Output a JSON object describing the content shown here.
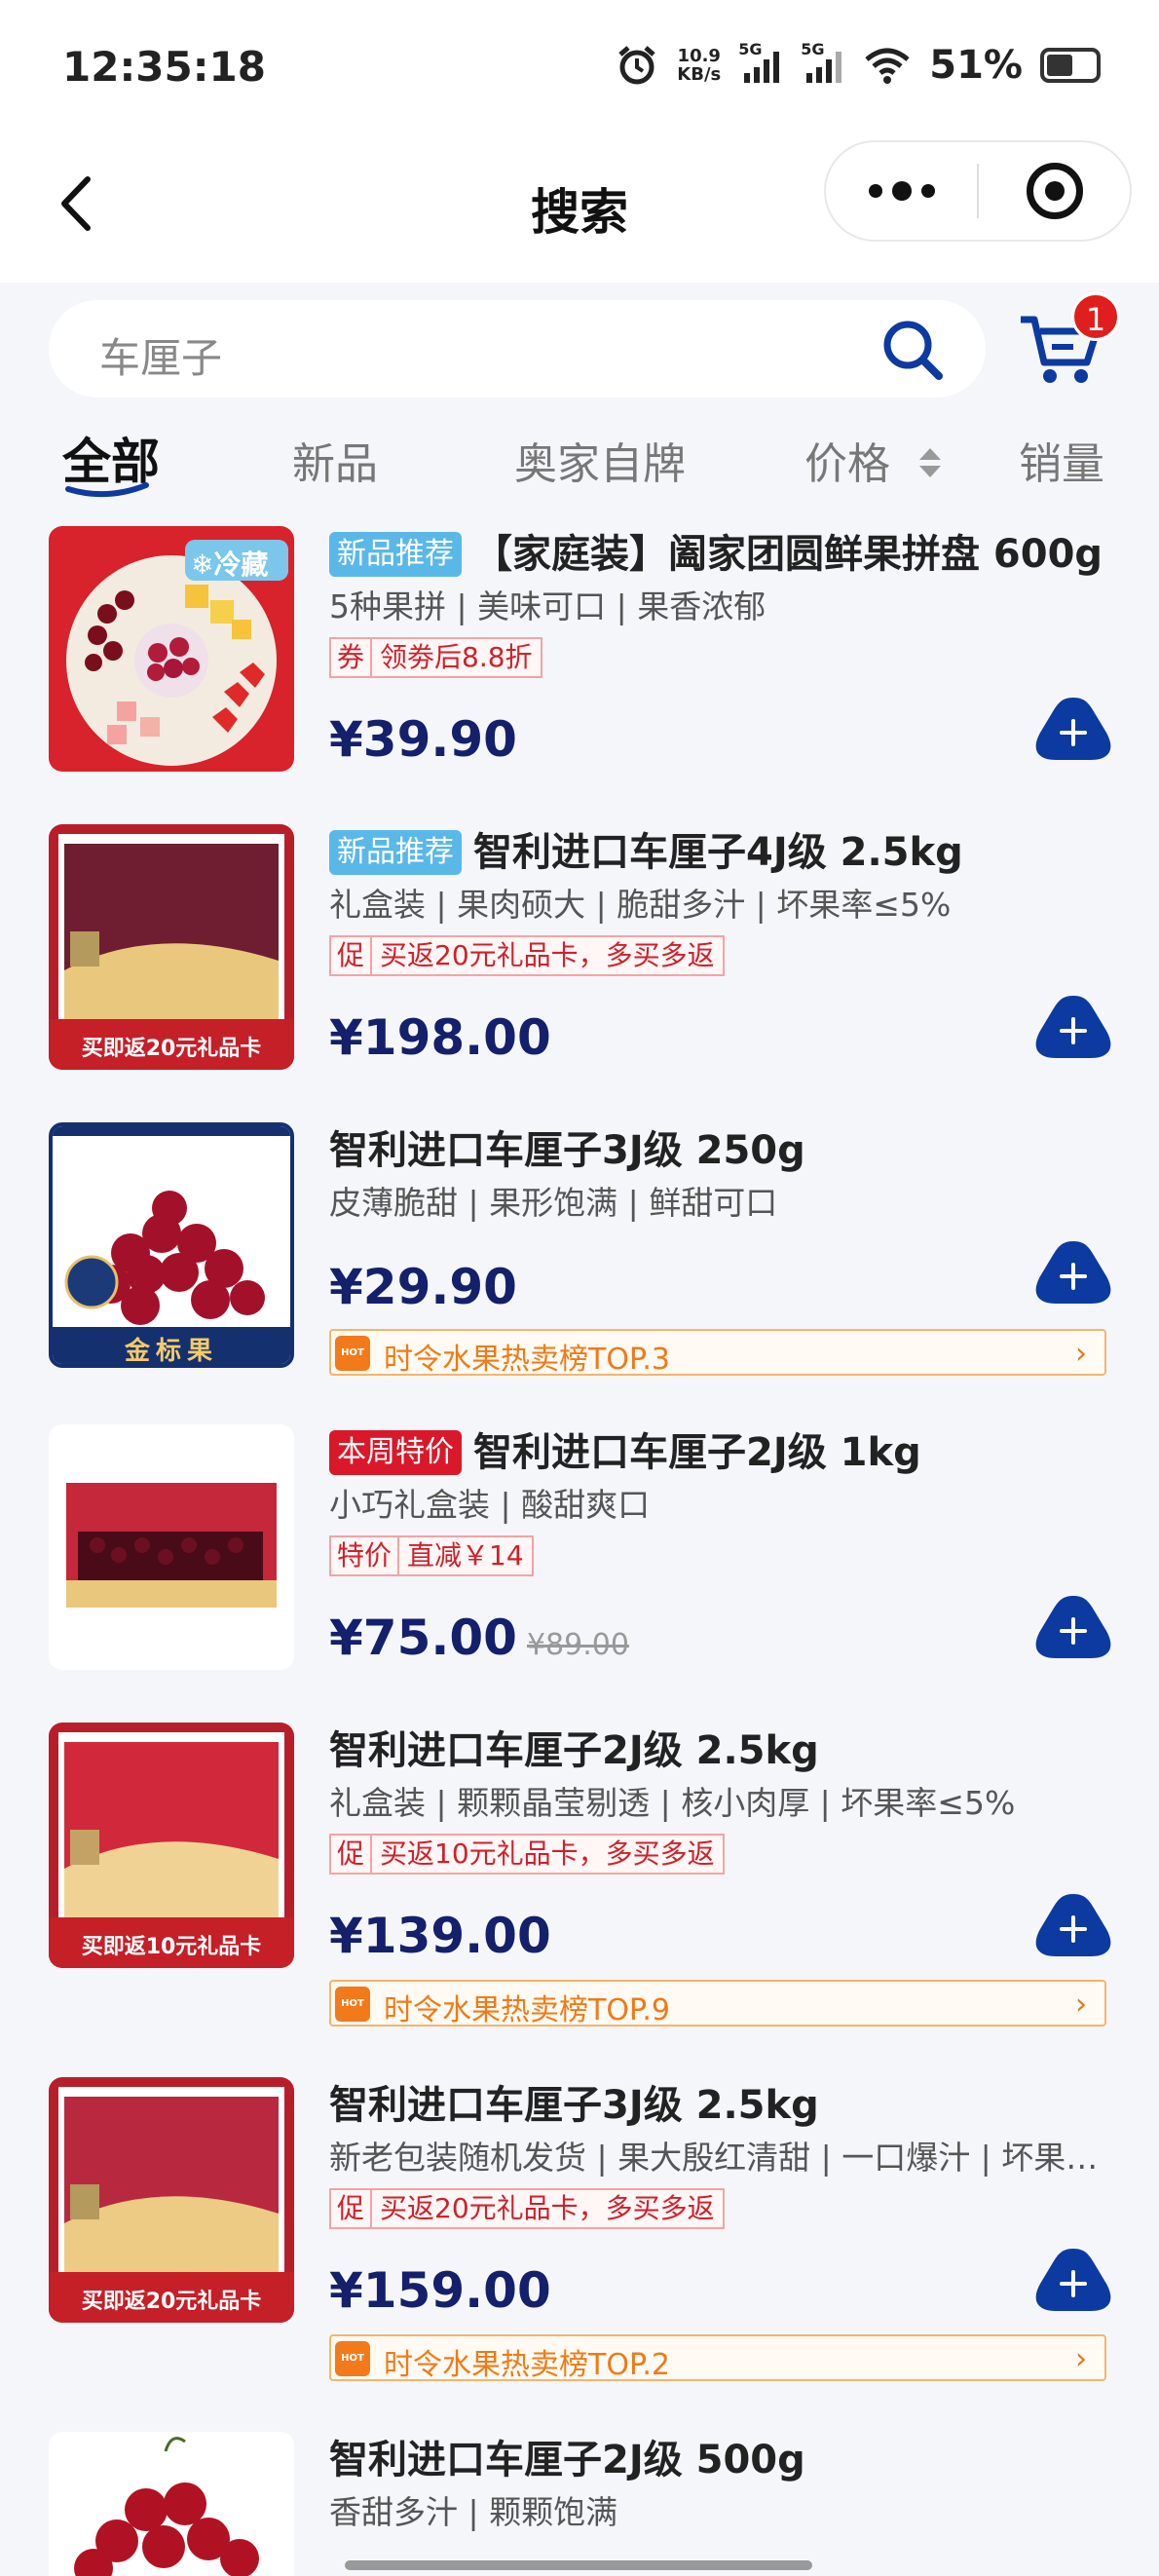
{
  "status_bar": {
    "time": "12:35:18",
    "net_speed_value": "10.9",
    "net_speed_unit": "KB/s",
    "signal_1": "5G",
    "signal_2": "5G",
    "battery": "51%"
  },
  "nav": {
    "title": "搜索"
  },
  "search": {
    "query": "车厘子"
  },
  "cart": {
    "count": "1"
  },
  "tabs": [
    {
      "label": "全部"
    },
    {
      "label": "新品"
    },
    {
      "label": "奥家自牌"
    },
    {
      "label": "价格"
    },
    {
      "label": "销量"
    }
  ],
  "products": [
    {
      "badge": "新品推荐",
      "title": "【家庭装】阖家团圆鲜果拼盘 600g",
      "subtitle": "5种果拼 | 美味可口 | 果香浓郁",
      "promo_key": "券",
      "promo_text": "领劵后8.8折",
      "price": "¥39.90",
      "thumb_label": "❄冷藏"
    },
    {
      "badge": "新品推荐",
      "title": "智利进口车厘子4J级 2.5kg",
      "subtitle": "礼盒装 | 果肉硕大 | 脆甜多汁 | 坏果率≤5%",
      "promo_key": "促",
      "promo_text": "买返20元礼品卡，多买多返",
      "price": "¥198.00",
      "thumb_label": "买即返20元礼品卡"
    },
    {
      "title": "智利进口车厘子3J级 250g",
      "subtitle": "皮薄脆甜 | 果形饱满 | 鲜甜可口",
      "price": "¥29.90",
      "rank": "时令水果热卖榜TOP.3",
      "thumb_label": "金标果"
    },
    {
      "badge": "本周特价",
      "title": "智利进口车厘子2J级 1kg",
      "subtitle": "小巧礼盒装 | 酸甜爽口",
      "promo_key": "特价",
      "promo_text": "直减￥14",
      "price": "¥75.00",
      "old_price": "¥89.00"
    },
    {
      "title": "智利进口车厘子2J级 2.5kg",
      "subtitle": "礼盒装 | 颗颗晶莹剔透 | 核小肉厚 | 坏果率≤5%",
      "promo_key": "促",
      "promo_text": "买返10元礼品卡，多买多返",
      "price": "¥139.00",
      "rank": "时令水果热卖榜TOP.9",
      "thumb_label": "买即返10元礼品卡"
    },
    {
      "title": "智利进口车厘子3J级 2.5kg",
      "subtitle": "新老包装随机发货 | 果大殷红清甜 | 一口爆汁 | 坏果率…",
      "promo_key": "促",
      "promo_text": "买返20元礼品卡，多买多返",
      "price": "¥159.00",
      "rank": "时令水果热卖榜TOP.2",
      "thumb_label": "买即返20元礼品卡"
    },
    {
      "title": "智利进口车厘子2J级 500g",
      "subtitle": "香甜多汁 | 颗颗饱满"
    }
  ],
  "colors": {
    "price": "#14206b",
    "accent_blue": "#0d3aa0",
    "tag_blue": "#5ab8e8",
    "tag_red": "#d9182a",
    "rank_orange": "#f07a16"
  }
}
